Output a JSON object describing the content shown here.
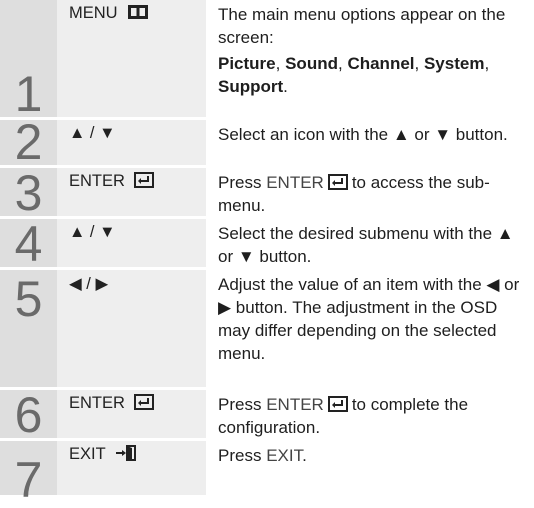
{
  "steps": [
    {
      "num": "1",
      "button": "MENU",
      "button_icon": "menu-icon",
      "desc": "The main menu options appear on the screen:",
      "menu_items": [
        "Picture",
        "Sound",
        "Channel",
        "System",
        "Support"
      ]
    },
    {
      "num": "2",
      "button": "▲ / ▼",
      "desc": "Select an icon with the ▲ or ▼ button."
    },
    {
      "num": "3",
      "button": "ENTER",
      "button_icon": "enter-icon",
      "desc_prefix": "Press",
      "desc_key": "ENTER",
      "desc_suffix": "to access the sub-menu."
    },
    {
      "num": "4",
      "button": "▲ / ▼",
      "desc": "Select the desired submenu with the ▲ or ▼ button."
    },
    {
      "num": "5",
      "button": "◀ / ▶",
      "desc": "Adjust the value of an item with the ◀ or ▶ button. The adjustment in the OSD may differ depending on the selected menu."
    },
    {
      "num": "6",
      "button": "ENTER",
      "button_icon": "enter-icon",
      "desc_prefix": "Press",
      "desc_key": "ENTER",
      "desc_suffix": "to complete the configuration."
    },
    {
      "num": "7",
      "button": "EXIT",
      "button_icon": "exit-icon",
      "desc_prefix": "Press",
      "desc_key": "EXIT",
      "desc_suffix": "."
    }
  ]
}
